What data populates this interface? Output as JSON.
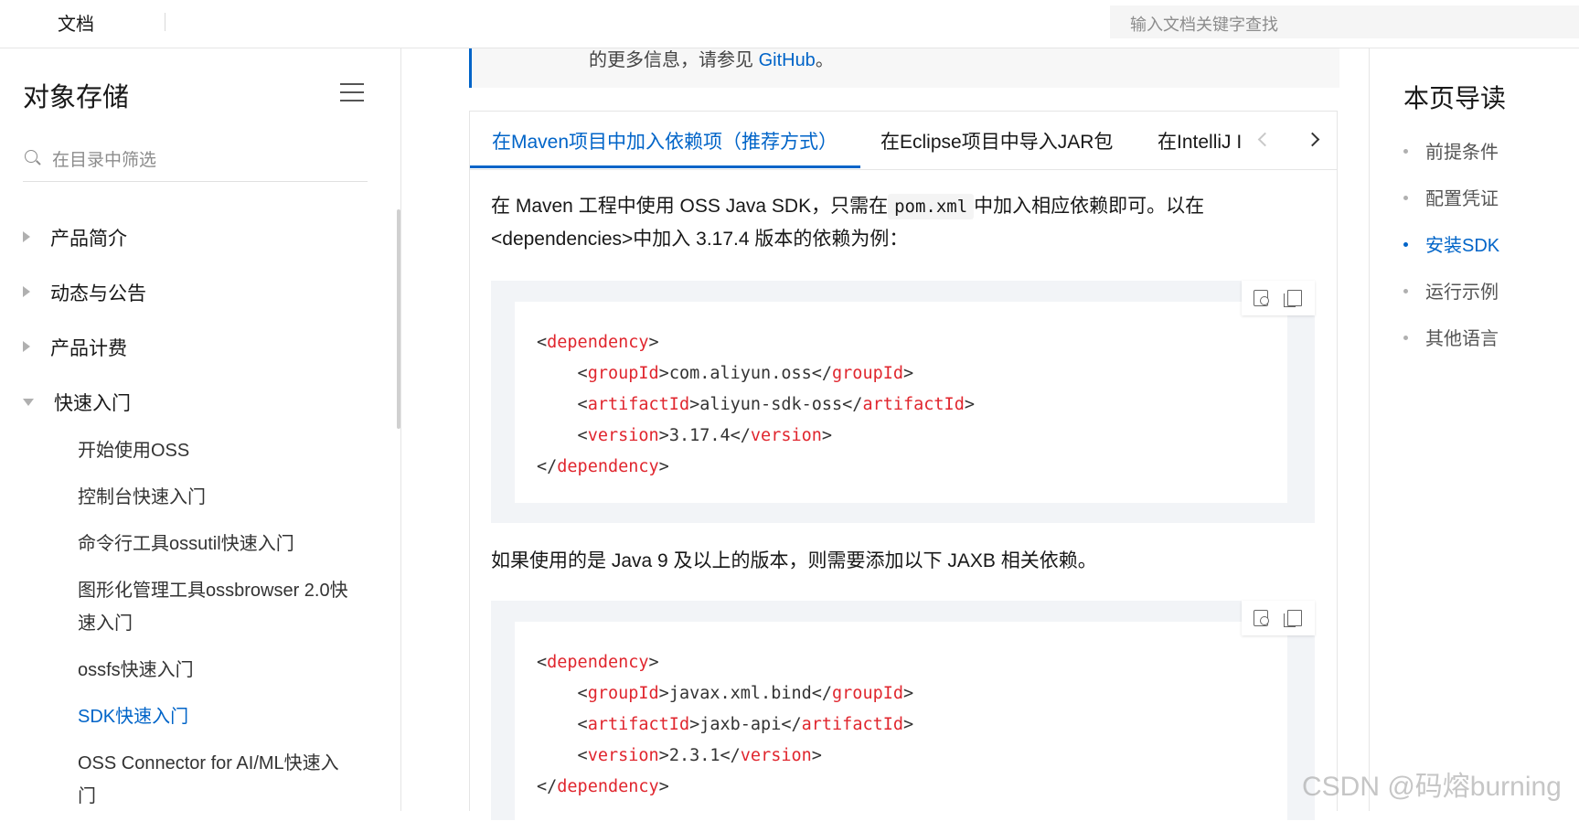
{
  "colors": {
    "accent": "#0064c8",
    "code_tag": "#e0262e"
  },
  "header": {
    "title": "文档",
    "search_placeholder": "输入文档关键字查找"
  },
  "sidebar": {
    "title": "对象存储",
    "filter_placeholder": "在目录中筛选",
    "items": [
      {
        "label": "产品简介",
        "state": "collapsed"
      },
      {
        "label": "动态与公告",
        "state": "collapsed"
      },
      {
        "label": "产品计费",
        "state": "collapsed"
      },
      {
        "label": "快速入门",
        "state": "expanded"
      }
    ],
    "subitems": [
      {
        "label": "开始使用OSS"
      },
      {
        "label": "控制台快速入门"
      },
      {
        "label": "命令行工具ossutil快速入门"
      },
      {
        "label": "图形化管理工具ossbrowser 2.0快速入门"
      },
      {
        "label": "ossfs快速入门"
      },
      {
        "label": "SDK快速入门",
        "active": true
      },
      {
        "label": "OSS Connector for AI/ML快速入门"
      }
    ]
  },
  "note": {
    "text": "的更多信息，请参见 ",
    "link": "GitHub",
    "suffix": "。"
  },
  "tabs": [
    {
      "label": "在Maven项目中加入依赖项（推荐方式）",
      "active": true
    },
    {
      "label": "在Eclipse项目中导入JAR包"
    },
    {
      "label": "在IntelliJ I"
    }
  ],
  "content": {
    "para1_a": "在 Maven 工程中使用 OSS Java SDK，只需在",
    "para1_code": "pom.xml",
    "para1_b": "中加入相应依赖即可。以在",
    "para1_c": "<dependencies>中加入 3.17.4 版本的依赖为例：",
    "para2": "如果使用的是 Java 9 及以上的版本，则需要添加以下 JAXB 相关依赖。",
    "code1": {
      "dependency_tag": "dependency",
      "groupId_tag": "groupId",
      "groupId": "com.aliyun.oss",
      "artifactId_tag": "artifactId",
      "artifactId": "aliyun-sdk-oss",
      "version_tag": "version",
      "version": "3.17.4"
    },
    "code2": {
      "dependency_tag": "dependency",
      "groupId_tag": "groupId",
      "groupId": "javax.xml.bind",
      "artifactId_tag": "artifactId",
      "artifactId": "jaxb-api",
      "version_tag": "version",
      "version": "2.3.1"
    }
  },
  "toc": {
    "title": "本页导读",
    "items": [
      {
        "label": "前提条件"
      },
      {
        "label": "配置凭证"
      },
      {
        "label": "安装SDK",
        "active": true
      },
      {
        "label": "运行示例"
      },
      {
        "label": "其他语言"
      }
    ]
  },
  "watermark": "CSDN @码熔burning"
}
